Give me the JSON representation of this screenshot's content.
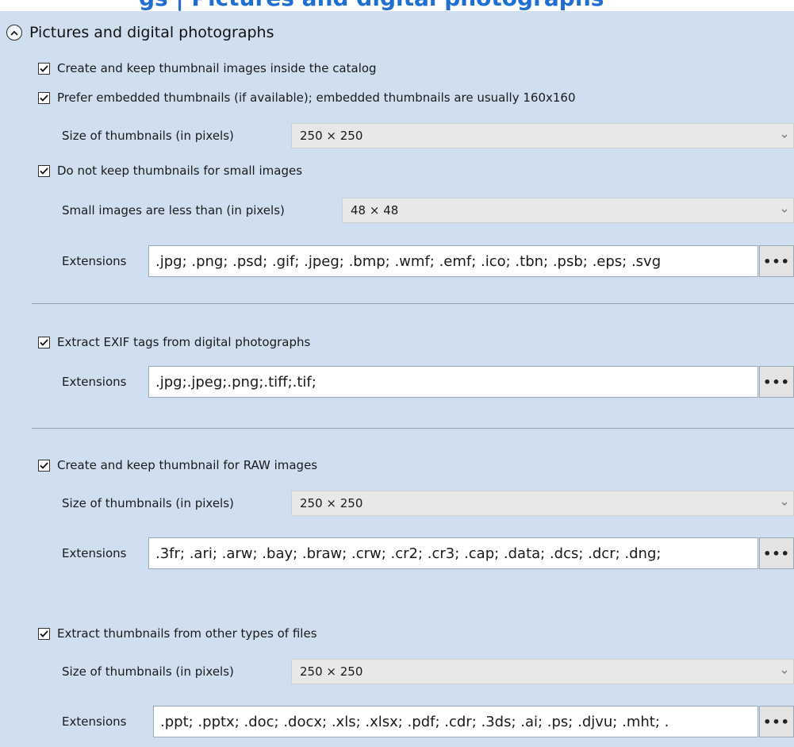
{
  "heading_partial": "gs | Pictures and digital photographs",
  "section": {
    "title": "Pictures and digital photographs",
    "icon": "chevron-up-icon",
    "expanded": true
  },
  "thumbs": {
    "create_label": "Create and keep thumbnail images inside the catalog",
    "create_checked": true,
    "prefer_label": "Prefer embedded thumbnails (if available); embedded thumbnails are usually 160x160",
    "prefer_checked": true,
    "size_label": "Size of thumbnails (in pixels)",
    "size_value": "250 × 250",
    "small_label": "Do not keep thumbnails for small images",
    "small_checked": true,
    "small_size_label": "Small images are less than (in pixels)",
    "small_size_value": "48 × 48",
    "ext_label": "Extensions",
    "ext_value": ".jpg; .png; .psd; .gif; .jpeg; .bmp; .wmf; .emf; .ico; .tbn; .psb; .eps; .svg",
    "ext_button": "•••"
  },
  "exif": {
    "label": "Extract EXIF tags from digital photographs",
    "checked": true,
    "ext_label": "Extensions",
    "ext_value": ".jpg;.jpeg;.png;.tiff;.tif;",
    "ext_button": "•••"
  },
  "raw": {
    "label": "Create and keep thumbnail for RAW images",
    "checked": true,
    "size_label": "Size of thumbnails (in pixels)",
    "size_value": "250 × 250",
    "ext_label": "Extensions",
    "ext_value": ".3fr; .ari; .arw; .bay; .braw; .crw; .cr2; .cr3; .cap; .data; .dcs; .dcr; .dng;",
    "ext_button": "•••"
  },
  "other": {
    "label": "Extract thumbnails from other types of files",
    "checked": true,
    "size_label": "Size of thumbnails (in pixels)",
    "size_value": "250 × 250",
    "ext_label": "Extensions",
    "ext_value": ".ppt; .pptx; .doc; .docx; .xls; .xlsx; .pdf; .cdr; .3ds; .ai; .ps; .djvu; .mht; .",
    "ext_button": "•••"
  },
  "icons": {
    "check": "checkmark-icon",
    "dropdown": "chevron-down-icon"
  },
  "colors": {
    "panel": "#cfdff0",
    "accent": "#1e6fd0",
    "field": "#ffffff",
    "combo": "#e8e8e8"
  }
}
